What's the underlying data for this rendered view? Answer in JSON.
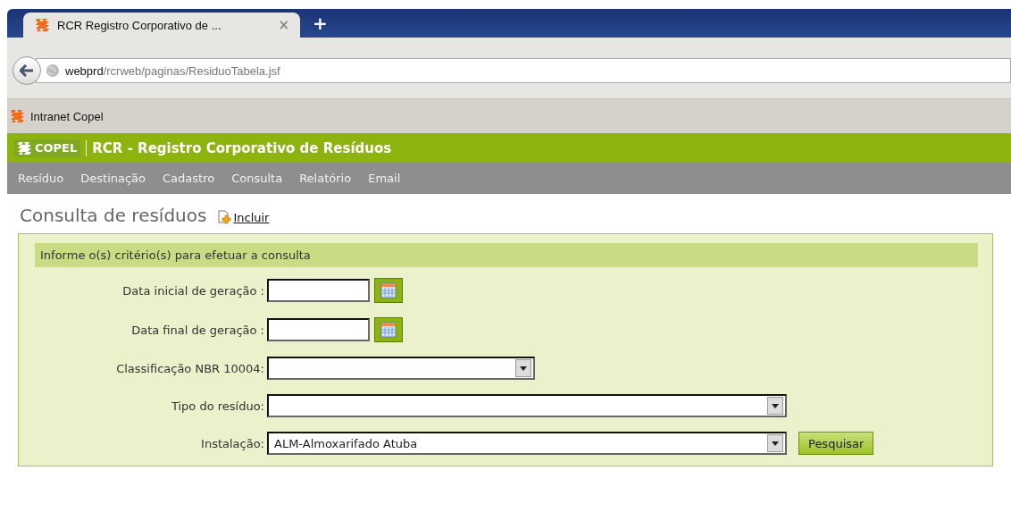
{
  "browser": {
    "tab": {
      "title": "RCR Registro Corporativo de ...",
      "close": "×"
    },
    "new_tab": "+",
    "url": "webprd/rcrweb/paginas/ResiduoTabela.jsf",
    "bookmarks": [
      {
        "label": "Intranet Copel"
      }
    ]
  },
  "header": {
    "logo": "COPEL",
    "title": "RCR - Registro Corporativo de Resíduos"
  },
  "menu": [
    {
      "label": "Resíduo"
    },
    {
      "label": "Destinação"
    },
    {
      "label": "Cadastro"
    },
    {
      "label": "Consulta"
    },
    {
      "label": "Relatório"
    },
    {
      "label": "Email"
    }
  ],
  "page": {
    "title": "Consulta de resíduos",
    "add_link": "Incluir"
  },
  "form": {
    "heading": "Informe o(s) critério(s) para efetuar a consulta",
    "fields": [
      {
        "kind": "date",
        "label": "Data inicial de geração :"
      },
      {
        "kind": "date",
        "label": "Data final de geração :"
      },
      {
        "kind": "short-select",
        "label": "Classificação NBR 10004:"
      },
      {
        "kind": "select",
        "label": "Tipo do resíduo:"
      },
      {
        "kind": "select",
        "label": "Instalação:",
        "value": "ALM-Almoxarifado Atuba"
      }
    ],
    "search_button": "Pesquisar"
  }
}
